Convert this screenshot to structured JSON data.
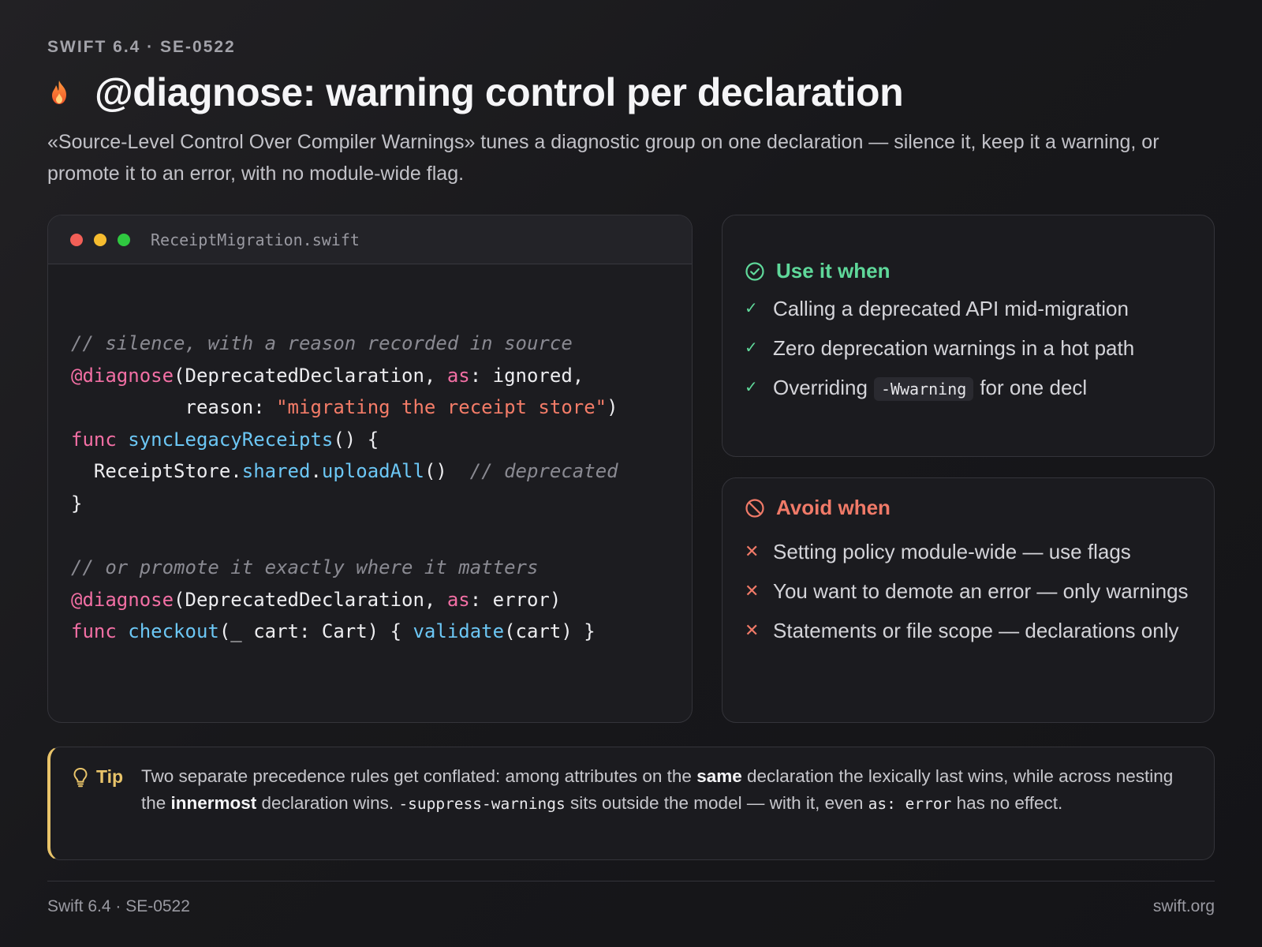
{
  "header": {
    "eyebrow": "SWIFT 6.4 · SE-0522",
    "title": "@diagnose: warning control per declaration",
    "subtitle": "«Source-Level Control Over Compiler Warnings» tunes a diagnostic group on one declaration — silence it, keep it a warning, or promote it to an error, with no module-wide flag."
  },
  "code": {
    "filename": "ReceiptMigration.swift",
    "lines": [
      [
        {
          "t": "// silence, with a reason recorded in source",
          "k": "com"
        }
      ],
      [
        {
          "t": "@diagnose",
          "k": "attr"
        },
        {
          "t": "(DeprecatedDeclaration, ",
          "k": ""
        },
        {
          "t": "as",
          "k": "kw"
        },
        {
          "t": ": ignored,",
          "k": ""
        }
      ],
      [
        {
          "t": "          reason: ",
          "k": ""
        },
        {
          "t": "\"migrating the receipt store\"",
          "k": "str"
        },
        {
          "t": ")",
          "k": ""
        }
      ],
      [
        {
          "t": "func ",
          "k": "kw"
        },
        {
          "t": "syncLegacyReceipts",
          "k": "fn"
        },
        {
          "t": "() {",
          "k": ""
        }
      ],
      [
        {
          "t": "  ReceiptStore.",
          "k": ""
        },
        {
          "t": "shared",
          "k": "fn"
        },
        {
          "t": ".",
          "k": ""
        },
        {
          "t": "uploadAll",
          "k": "fn"
        },
        {
          "t": "()  ",
          "k": ""
        },
        {
          "t": "// deprecated",
          "k": "com"
        }
      ],
      [
        {
          "t": "}",
          "k": ""
        }
      ],
      [
        {
          "t": "",
          "k": ""
        }
      ],
      [
        {
          "t": "// or promote it exactly where it matters",
          "k": "com"
        }
      ],
      [
        {
          "t": "@diagnose",
          "k": "attr"
        },
        {
          "t": "(DeprecatedDeclaration, ",
          "k": ""
        },
        {
          "t": "as",
          "k": "kw"
        },
        {
          "t": ": error)",
          "k": ""
        }
      ],
      [
        {
          "t": "func ",
          "k": "kw"
        },
        {
          "t": "checkout",
          "k": "fn"
        },
        {
          "t": "(_ cart: Cart) { ",
          "k": ""
        },
        {
          "t": "validate",
          "k": "fn"
        },
        {
          "t": "(cart) }",
          "k": ""
        }
      ]
    ]
  },
  "use_panel": {
    "title": "Use it when",
    "items": [
      {
        "parts": [
          {
            "t": "Calling a deprecated API mid-migration"
          }
        ]
      },
      {
        "parts": [
          {
            "t": "Zero deprecation warnings in a hot path"
          }
        ]
      },
      {
        "parts": [
          {
            "t": "Overriding"
          },
          {
            "t": "-Wwarning",
            "code": true
          },
          {
            "t": "for one decl"
          }
        ]
      }
    ]
  },
  "avoid_panel": {
    "title": "Avoid when",
    "items": [
      {
        "parts": [
          {
            "t": "Setting policy module-wide — use flags"
          }
        ]
      },
      {
        "parts": [
          {
            "t": "You want to demote an error — only warnings"
          }
        ]
      },
      {
        "parts": [
          {
            "t": "Statements or file scope — declarations only"
          }
        ]
      }
    ]
  },
  "tip": {
    "label": "Tip",
    "parts": [
      {
        "t": "Two separate precedence rules get conflated: among attributes on the "
      },
      {
        "t": "same",
        "b": true
      },
      {
        "t": " declaration the lexically last wins, while across nesting the "
      },
      {
        "t": "innermost",
        "b": true
      },
      {
        "t": " declaration wins. "
      },
      {
        "t": "-suppress-warnings",
        "code": true
      },
      {
        "t": " sits outside the model — with it, even "
      },
      {
        "t": "as: error",
        "code": true
      },
      {
        "t": " has no effect."
      }
    ]
  },
  "footer": {
    "left": "Swift 6.4 · SE-0522",
    "right": "swift.org"
  },
  "colors": {
    "accent_green": "#5fd89a",
    "accent_red": "#f07a68",
    "accent_yellow": "#e9c46a",
    "syntax_keyword": "#f26fa4",
    "syntax_string": "#f47c68",
    "syntax_function": "#6cc7f5"
  },
  "icons": {
    "title": "flame-icon",
    "use": "check-circle-icon",
    "avoid": "prohibited-icon",
    "tip": "lightbulb-icon"
  }
}
